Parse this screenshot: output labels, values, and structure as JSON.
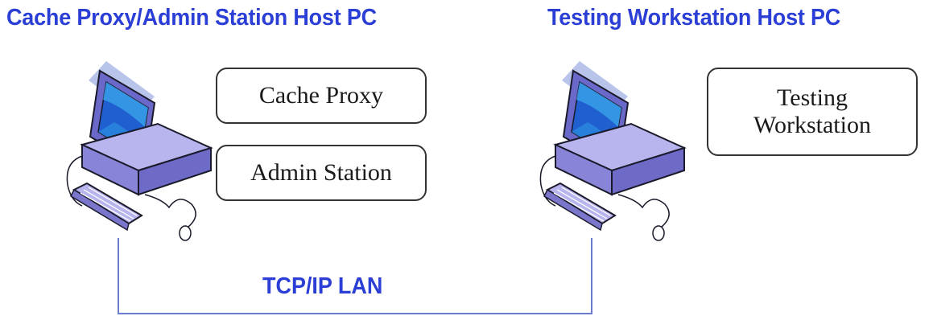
{
  "hosts": [
    {
      "title": "Cache Proxy/Admin Station Host PC",
      "components": [
        "Cache Proxy",
        "Admin Station"
      ]
    },
    {
      "title": "Testing Workstation Host PC",
      "components": [
        "Testing\nWorkstation"
      ]
    }
  ],
  "network": {
    "label": "TCP/IP LAN"
  },
  "icons": {
    "computer": "desktop-computer-icon"
  },
  "colors": {
    "heading": "#2b3fd6",
    "line": "#6a7bd0"
  }
}
